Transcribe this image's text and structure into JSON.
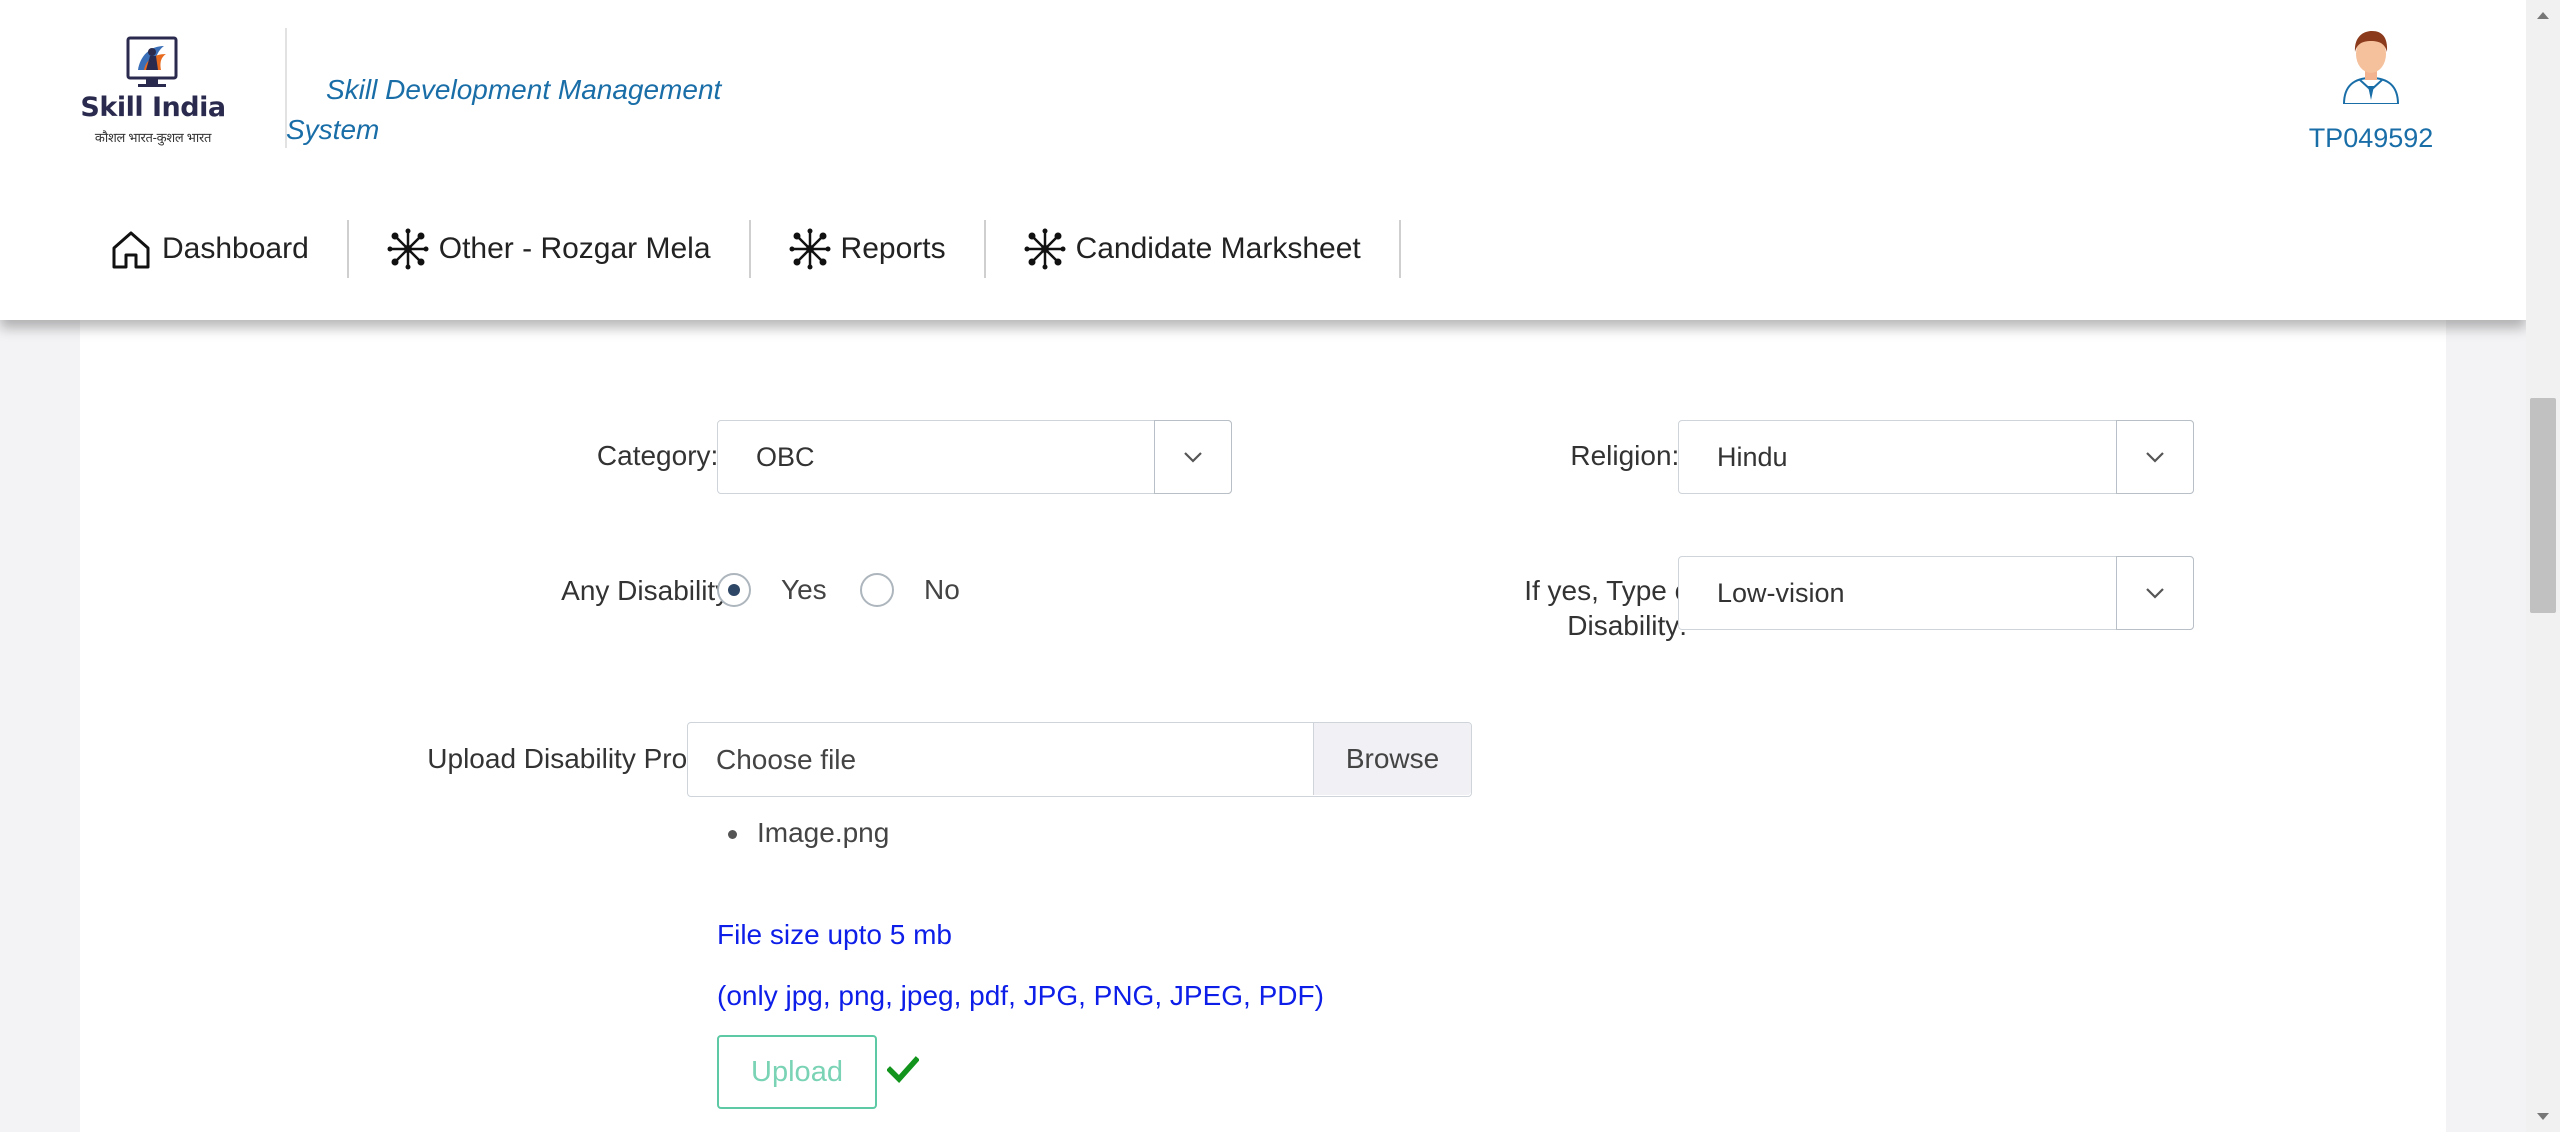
{
  "header": {
    "logo_title": "Skill India",
    "logo_subtitle": "कौशल भारत-कुशल भारत",
    "system_title": "Skill Development Management System",
    "user_id": "TP049592"
  },
  "nav": {
    "items": [
      {
        "label": "Dashboard",
        "icon": "home-icon"
      },
      {
        "label": "Other - Rozgar Mela",
        "icon": "network-icon"
      },
      {
        "label": "Reports",
        "icon": "network-icon"
      },
      {
        "label": "Candidate Marksheet",
        "icon": "network-icon"
      }
    ]
  },
  "form": {
    "category": {
      "label": "Category:",
      "required_mark": "*",
      "value": "OBC"
    },
    "religion": {
      "label": "Religion:",
      "required_mark": "*",
      "value": "Hindu"
    },
    "disability": {
      "label": "Any Disability:",
      "options": [
        {
          "label": "Yes",
          "selected": true
        },
        {
          "label": "No",
          "selected": false
        }
      ]
    },
    "disability_type": {
      "label_line1": "If yes, Type of",
      "label_line2": "Disability:",
      "required_mark": "*",
      "value": "Low-vision"
    },
    "disability_proof": {
      "label": "Upload Disability Proof:",
      "required_mark": "*",
      "placeholder": "Choose file",
      "browse_label": "Browse",
      "files": [
        "Image.png"
      ],
      "note_size": "File size upto 5 mb",
      "note_types": "(only jpg, png, jpeg, pdf, JPG, PNG, JPEG, PDF)",
      "upload_label": "Upload",
      "upload_status_icon": "checkmark-icon"
    }
  },
  "colors": {
    "brand_blue": "#1a6ea8",
    "required_red": "#e0202a",
    "note_blue": "#0d1ee8",
    "upload_green": "#5dc9a5",
    "check_green": "#12941d"
  }
}
